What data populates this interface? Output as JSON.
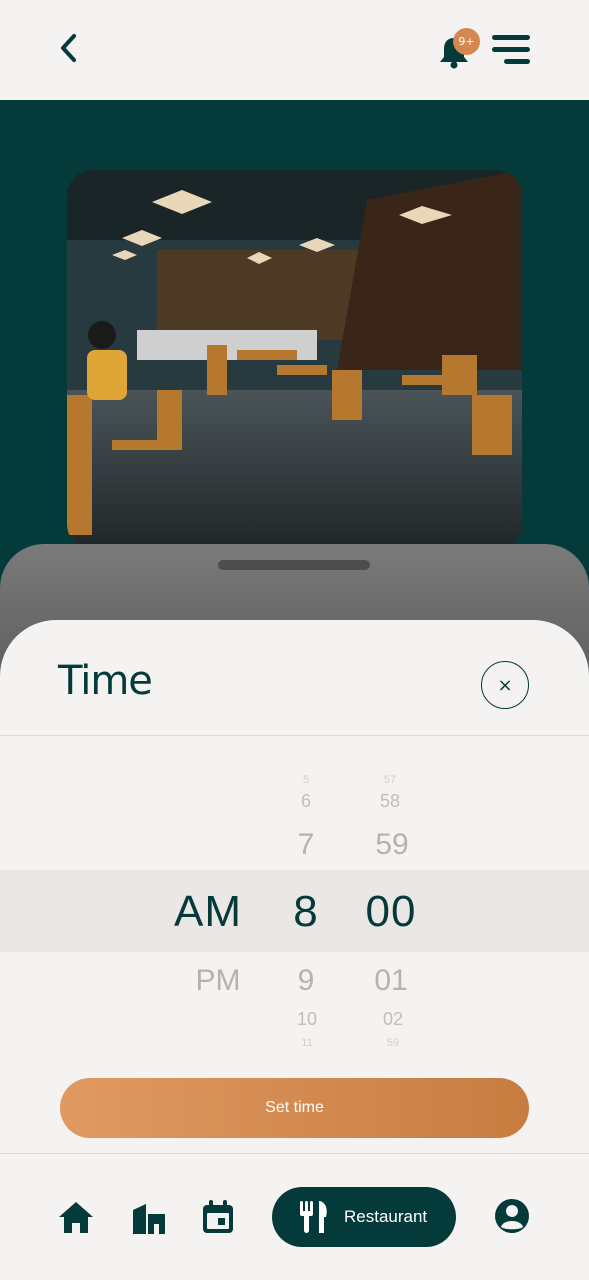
{
  "header": {
    "back_icon": "chevron-left-icon",
    "notifications": {
      "icon": "bell-icon",
      "badge": "9+"
    },
    "menu_icon": "hamburger-menu-icon"
  },
  "hero": {
    "image": "restaurant-interior-photo"
  },
  "sheet": {
    "title": "Time",
    "close_label": "×",
    "picker": {
      "period": {
        "selected": "AM",
        "after": [
          "PM"
        ]
      },
      "hour": {
        "before": [
          "5",
          "6",
          "7"
        ],
        "selected": "8",
        "after": [
          "9",
          "10",
          "11"
        ]
      },
      "minute": {
        "before": [
          "57",
          "58",
          "59"
        ],
        "selected": "00",
        "after": [
          "01",
          "02",
          "59"
        ]
      }
    },
    "set_button_label": "Set time"
  },
  "bottom_nav": {
    "items": [
      {
        "icon": "home-icon"
      },
      {
        "icon": "buildings-icon"
      },
      {
        "icon": "calendar-icon"
      },
      {
        "icon": "restaurant-icon",
        "label": "Restaurant",
        "active": true
      },
      {
        "icon": "profile-icon"
      }
    ]
  },
  "colors": {
    "primary": "#053a3a",
    "accent": "#d5874f",
    "background": "#f4f3f1"
  }
}
